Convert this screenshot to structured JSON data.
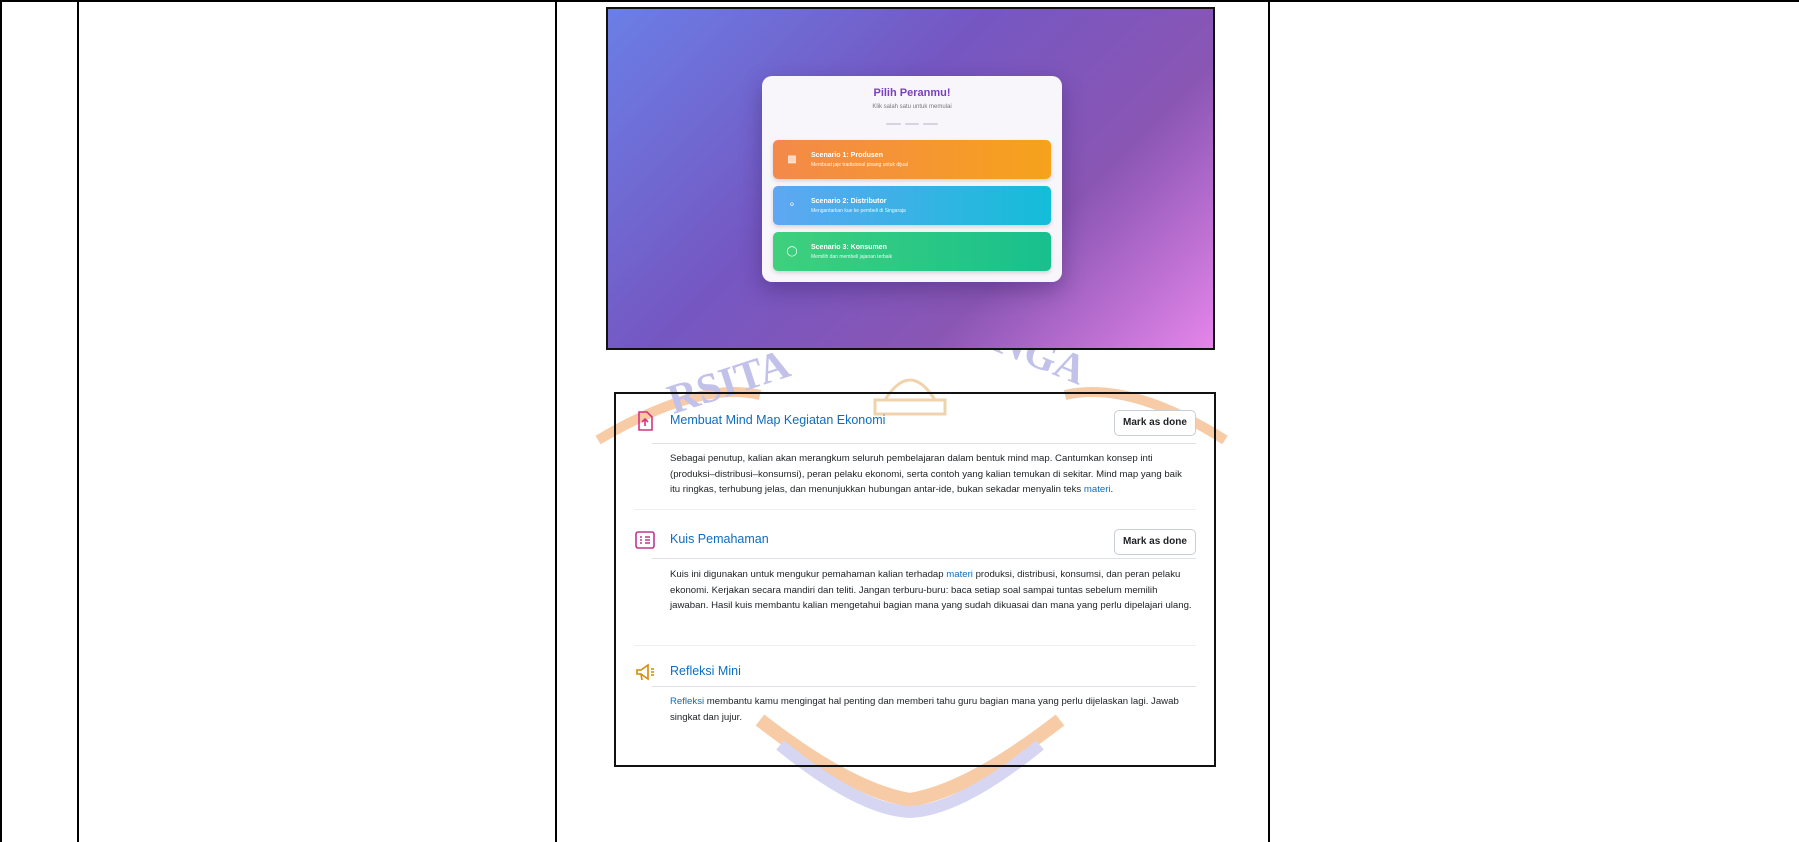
{
  "colors": {
    "link": "#0f6cbf",
    "scenario_title": "#7a3fc0",
    "icon_assignment": "#d63384",
    "icon_quiz": "#c0368f",
    "icon_feedback": "#d38b00",
    "watermark_orange": "#f2a15f",
    "watermark_violet": "#8f8fd8"
  },
  "scenario": {
    "title": "Pilih Peranmu!",
    "subtitle": "Klik salah satu untuk memulai",
    "options": [
      {
        "icon": "jar-icon",
        "name": "Scenario 1: Produsen",
        "desc": "Membuat jaje tradisional pisang untuk dijual"
      },
      {
        "icon": "scooter-icon",
        "name": "Scenario 2: Distributor",
        "desc": "Mengantarkan kue ke pembeli di Singaraja"
      },
      {
        "icon": "basket-icon",
        "name": "Scenario 3: Konsumen",
        "desc": "Memilih dan membeli jajanan terbaik"
      }
    ]
  },
  "watermark": {
    "left_text": "RSITA",
    "right_text": "NGA"
  },
  "course": {
    "activities": [
      {
        "icon": "assignment-upload-icon",
        "title": "Membuat Mind Map Kegiatan Ekonomi",
        "button": "Mark as done",
        "desc_before": "Sebagai penutup, kalian akan merangkum seluruh pembelajaran dalam bentuk mind map. Cantumkan konsep inti (produksi–distribusi–konsumsi), peran pelaku ekonomi, serta contoh yang kalian temukan di sekitar. Mind map yang baik itu ringkas, terhubung jelas, dan menunjukkan hubungan antar-ide, bukan sekadar menyalin teks ",
        "desc_link": "materi",
        "desc_after": "."
      },
      {
        "icon": "quiz-icon",
        "title": "Kuis Pemahaman",
        "button": "Mark as done",
        "desc_before": "Kuis ini digunakan untuk mengukur pemahaman kalian terhadap ",
        "desc_link": "materi",
        "desc_after": " produksi, distribusi, konsumsi, dan peran pelaku ekonomi. Kerjakan secara mandiri dan teliti. Jangan terburu-buru: baca setiap soal sampai tuntas sebelum memilih jawaban. Hasil kuis membantu kalian mengetahui bagian mana yang sudah dikuasai dan mana yang perlu dipelajari ulang."
      },
      {
        "icon": "feedback-megaphone-icon",
        "title": "Refleksi Mini",
        "desc_link": "Refleksi",
        "desc_after": " membantu kamu mengingat hal penting dan memberi tahu guru bagian mana yang perlu dijelaskan lagi. Jawab singkat dan jujur."
      }
    ]
  }
}
